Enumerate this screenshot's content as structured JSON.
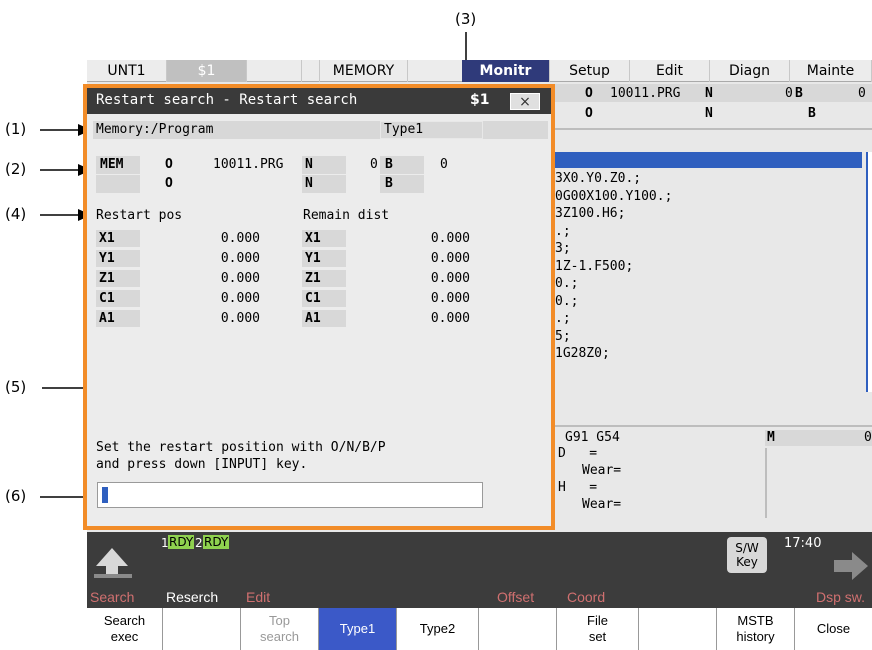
{
  "callouts": [
    "(1)",
    "(2)",
    "(3)",
    "(4)",
    "(5)",
    "(6)"
  ],
  "tabs": {
    "unit": "UNT1",
    "system": "$1",
    "mode": "MEMORY",
    "monitor": "Monitr",
    "setup": "Setup",
    "edit": "Edit",
    "diagn": "Diagn",
    "mainte": "Mainte"
  },
  "background": {
    "header_row1": {
      "o_label": "O",
      "o_value": "10011.PRG",
      "n_label": "N",
      "n_value": "0",
      "b_label": "B",
      "b_value": "0"
    },
    "header_row2": {
      "o_label": "O",
      "n_label": "N",
      "b_label": "B"
    },
    "program_lines": [
      "3X0.Y0.Z0.;",
      "0G00X100.Y100.;",
      "3Z100.H6;",
      ".;",
      "3;",
      "1Z-1.F500;",
      "0.;",
      "0.;",
      ".;",
      "5;",
      "1G28Z0;"
    ],
    "modal": "G91 G54",
    "m_label": "M",
    "m_value": "0",
    "d_label": "D   =",
    "d_wear": "Wear=",
    "h_label": "H   =",
    "h_wear": "Wear="
  },
  "dialog": {
    "title": "Restart search - Restart search",
    "system": "$1",
    "close": "×",
    "memory_label": "Memory:/Program",
    "type_label": "Type1",
    "mode_badge": "MEM",
    "row1": {
      "o_label": "O",
      "o_value": "10011.PRG",
      "n_label": "N",
      "n_value": "0",
      "b_label": "B",
      "b_value": "0"
    },
    "row2": {
      "o_label": "O",
      "n_label": "N",
      "b_label": "B"
    },
    "restart_pos_header": "Restart pos",
    "remain_dist_header": "Remain dist",
    "axes": [
      {
        "name": "X1",
        "restart": "0.000",
        "remain": "0.000"
      },
      {
        "name": "Y1",
        "restart": "0.000",
        "remain": "0.000"
      },
      {
        "name": "Z1",
        "restart": "0.000",
        "remain": "0.000"
      },
      {
        "name": "C1",
        "restart": "0.000",
        "remain": "0.000"
      },
      {
        "name": "A1",
        "restart": "0.000",
        "remain": "0.000"
      }
    ],
    "message_line1": "Set the restart position with O/N/B/P",
    "message_line2": "and press down [INPUT] key.",
    "input_value": ""
  },
  "status": {
    "rdy1_num": "1",
    "rdy1": "RDY",
    "rdy2_num": "2",
    "rdy2": "RDY",
    "sw_key": "S/W\nKey",
    "time": "17:40"
  },
  "menu_titles": [
    "Search",
    "Reserch",
    "Edit",
    "Offset",
    "Coord",
    "Dsp sw."
  ],
  "softkeys": [
    "Search\nexec",
    "",
    "Top\nsearch",
    "Type1",
    "Type2",
    "",
    "File\nset",
    "",
    "MSTB\nhistory",
    "Close"
  ],
  "colors": {
    "accent_orange": "#f28c28",
    "active_tab": "#2f3a7a",
    "dialog_title_bg": "#3a3a3a",
    "softkey_active": "#3b59c8",
    "rdy_green": "#8fd14f",
    "menu_title_red": "#d07070"
  }
}
